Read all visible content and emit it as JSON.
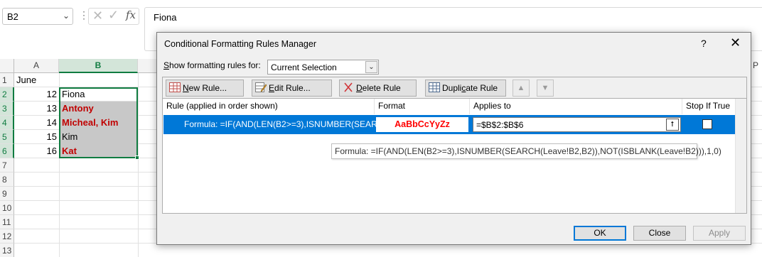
{
  "formula_bar": {
    "name_box": "B2",
    "dots": "⋮",
    "cancel_icon": "✕",
    "enter_icon": "✓",
    "fx": "fx",
    "content": "Fiona"
  },
  "sheet": {
    "columns": [
      "A",
      "B"
    ],
    "rows": [
      "1",
      "2",
      "3",
      "4",
      "5",
      "6",
      "7",
      "8",
      "9",
      "10",
      "11",
      "12",
      "13"
    ],
    "cells": {
      "A1": "June",
      "A2": "12",
      "B2": "Fiona",
      "A3": "13",
      "B3": "Antony",
      "A4": "14",
      "B4": "Micheal, Kim",
      "A5": "15",
      "B5": "Kim",
      "A6": "16",
      "B6": "Kat"
    },
    "edge_col_label": "P"
  },
  "dialog": {
    "title": "Conditional Formatting Rules Manager",
    "help": "?",
    "close": "✕",
    "show_label_pre": "",
    "show_label_u": "S",
    "show_label_post": "how formatting rules for:",
    "show_value": "Current Selection",
    "toolbar": {
      "new_rule_u": "N",
      "new_rule_rest": "ew Rule...",
      "edit_rule_u": "E",
      "edit_rule_rest": "dit Rule...",
      "delete_rule_u": "D",
      "delete_rule_rest": "elete Rule",
      "duplicate_pre": "Dupli",
      "duplicate_u": "c",
      "duplicate_post": "ate Rule",
      "move_up": "▲",
      "move_down": "▼"
    },
    "columns": {
      "rule": "Rule (applied in order shown)",
      "format": "Format",
      "applies": "Applies to",
      "stop": "Stop If True"
    },
    "rule_row": {
      "formula": "Formula: =IF(AND(LEN(B2>=3),ISNUMBER(SEARCH...",
      "preview": "AaBbCcYyZz",
      "applies_to": "=$B$2:$B$6",
      "collapse_icon": "⭡"
    },
    "tooltip": "Formula: =IF(AND(LEN(B2>=3),ISNUMBER(SEARCH(Leave!B2,B2)),NOT(ISBLANK(Leave!B2))),1,0)",
    "buttons": {
      "ok": "OK",
      "close": "Close",
      "apply": "Apply"
    }
  },
  "colors": {
    "excel_green": "#107c41",
    "selection_blue": "#0078d7",
    "highlight_text": "#c00000",
    "preview_red": "#ff0000",
    "shade": "#c8c8c8"
  }
}
